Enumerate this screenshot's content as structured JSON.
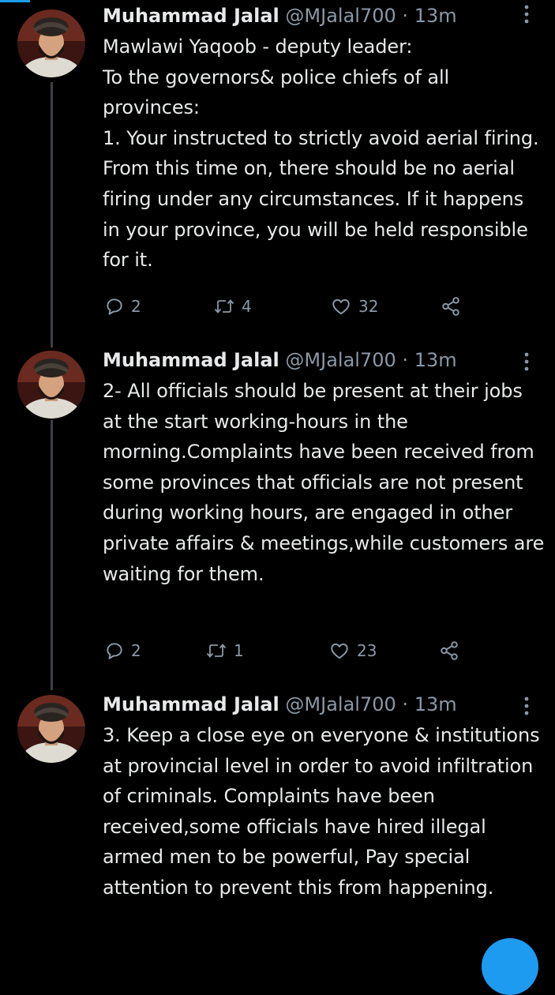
{
  "app": {
    "accent_color": "#1d9bf0",
    "text_color": "#e7e9ea",
    "muted_color": "#8b98a5",
    "background": "#000000"
  },
  "tweets": [
    {
      "author_name": "Muhammad Jalal",
      "handle": "@MJalal700",
      "separator": "·",
      "time": "13m",
      "text": "Mawlawi Yaqoob - deputy leader:\nTo the governors& police chiefs of all provinces:\n1. Your instructed to strictly avoid aerial firing. From this time on, there should be no aerial firing under any circumstances. If it happens in your province, you will be held responsible for it.",
      "replies": "2",
      "retweets": "4",
      "likes": "32",
      "icons": [
        "reply-icon",
        "retweet-icon",
        "like-icon",
        "share-icon",
        "more-icon"
      ]
    },
    {
      "author_name": "Muhammad Jalal",
      "handle": "@MJalal700",
      "separator": "·",
      "time": "13m",
      "text": "2- All officials should be present at their jobs at the start working-hours in the morning.Complaints have been received from some provinces that officials are not present during working hours, are engaged in other private affairs & meetings,while customers are waiting for them.",
      "replies": "2",
      "retweets": "1",
      "likes": "23",
      "icons": [
        "reply-icon",
        "retweet-icon",
        "like-icon",
        "share-icon",
        "more-icon"
      ]
    },
    {
      "author_name": "Muhammad Jalal",
      "handle": "@MJalal700",
      "separator": "·",
      "time": "13m",
      "text": "3. Keep a close eye on everyone & institutions at provincial level in order to avoid infiltration of criminals. Complaints have been received,some officials have hired illegal armed men to be powerful, Pay special attention to prevent this from happening.",
      "icons": [
        "more-icon"
      ]
    }
  ]
}
